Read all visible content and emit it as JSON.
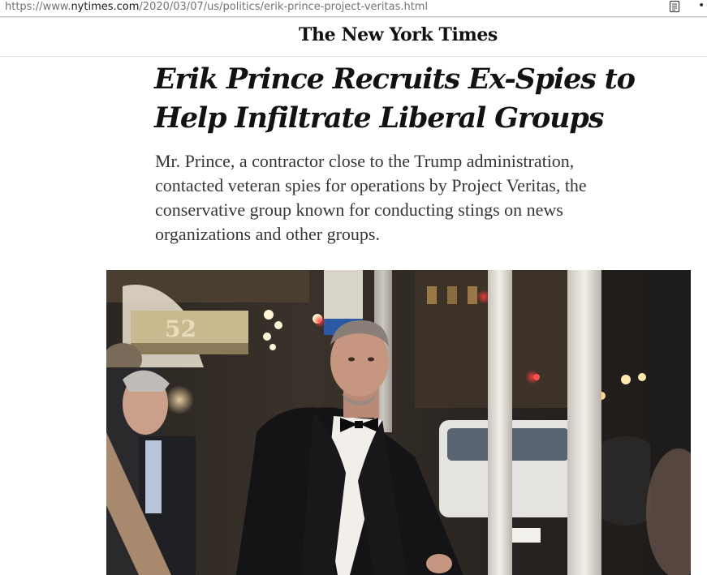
{
  "browser": {
    "url_prefix": "https://www.",
    "url_host": "nytimes.com",
    "url_path": "/2020/03/07/us/politics/erik-prince-project-veritas.html",
    "reader_icon": "reader-view-icon",
    "more_icon": "more-icon"
  },
  "masthead": {
    "logo_text": "The New York Times"
  },
  "article": {
    "headline": "Erik Prince Recruits Ex-Spies to Help Infiltrate Liberal Groups",
    "summary": "Mr. Prince, a contractor close to the Trump administration, contacted veteran spies for operations by Project Veritas, the conservative group known for conducting stings on news organizations and other groups."
  },
  "photo": {
    "building_number": "52"
  }
}
